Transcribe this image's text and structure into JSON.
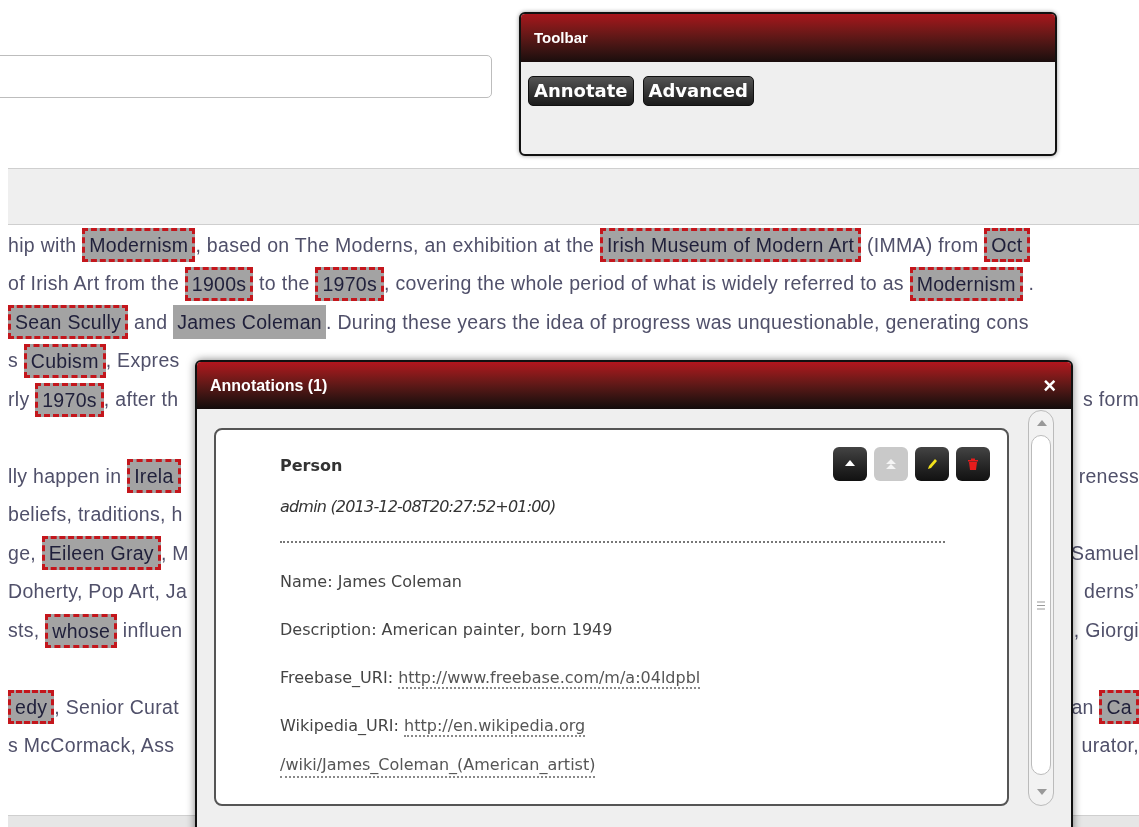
{
  "search": {
    "kind": "field"
  },
  "toolbar": {
    "title": "Toolbar",
    "buttons": [
      "Annotate",
      "Advanced"
    ]
  },
  "article": {
    "paragraphs": [
      {
        "lines": [
          {
            "left": [
              {
                "text": "hip with ",
                "kind": "plain"
              },
              {
                "text": "Modernism",
                "kind": "annotated"
              },
              {
                "text": ", based on The Moderns, an exhibition at the ",
                "kind": "plain"
              },
              {
                "text": "Irish Museum of Modern Art",
                "kind": "annotated"
              },
              {
                "text": " (IMMA) from ",
                "kind": "plain"
              },
              {
                "text": "Oct",
                "kind": "annotated"
              }
            ]
          },
          {
            "left": [
              {
                "text": "of Irish Art from the ",
                "kind": "plain"
              },
              {
                "text": "1900s",
                "kind": "annotated"
              },
              {
                "text": " to the ",
                "kind": "plain"
              },
              {
                "text": "1970s",
                "kind": "annotated"
              },
              {
                "text": ", covering the whole period of what is widely referred to as ",
                "kind": "plain"
              },
              {
                "text": "Modernism",
                "kind": "annotated"
              },
              {
                "text": " .",
                "kind": "plain"
              }
            ]
          },
          {
            "left": [
              {
                "text": "Sean Scully",
                "kind": "annotated"
              },
              {
                "text": " and ",
                "kind": "plain"
              },
              {
                "text": "James Coleman",
                "kind": "highlighted"
              },
              {
                "text": ". During these years the idea of progress was unquestionable, generating cons",
                "kind": "plain"
              }
            ]
          },
          {
            "left": [
              {
                "text": "s ",
                "kind": "plain"
              },
              {
                "text": "Cubism",
                "kind": "annotated"
              },
              {
                "text": ", Expres",
                "kind": "plain"
              }
            ]
          },
          {
            "left": [
              {
                "text": "rly ",
                "kind": "plain"
              },
              {
                "text": "1970s",
                "kind": "annotated"
              },
              {
                "text": ", after th",
                "kind": "plain"
              }
            ],
            "right": [
              {
                "text": "s form",
                "kind": "plain"
              }
            ]
          }
        ]
      },
      {
        "lines": [
          {
            "left": [
              {
                "text": "lly happen in ",
                "kind": "plain"
              },
              {
                "text": "Irela",
                "kind": "annotated"
              }
            ],
            "right": [
              {
                "text": "reness",
                "kind": "plain"
              }
            ]
          },
          {
            "left": [
              {
                "text": "beliefs, traditions, h",
                "kind": "plain"
              }
            ]
          },
          {
            "left": [
              {
                "text": "ge, ",
                "kind": "plain"
              },
              {
                "text": "Eileen Gray",
                "kind": "annotated"
              },
              {
                "text": ", M",
                "kind": "plain"
              }
            ],
            "right": [
              {
                "text": "Samuel",
                "kind": "plain"
              }
            ]
          },
          {
            "left": [
              {
                "text": "Doherty, Pop Art, Ja",
                "kind": "plain"
              }
            ],
            "right": [
              {
                "text": "derns’",
                "kind": "plain"
              }
            ]
          },
          {
            "left": [
              {
                "text": "sts, ",
                "kind": "plain"
              },
              {
                "text": "whose",
                "kind": "annotated"
              },
              {
                "text": " influen",
                "kind": "plain"
              }
            ],
            "right": [
              {
                "text": ", Giorgi",
                "kind": "plain"
              }
            ]
          }
        ]
      },
      {
        "lines": [
          {
            "left": [
              {
                "text": "edy",
                "kind": "annotated"
              },
              {
                "text": ", Senior Curat",
                "kind": "plain"
              }
            ],
            "right": [
              {
                "text": "an ",
                "kind": "plain"
              },
              {
                "text": "Ca",
                "kind": "annotated"
              }
            ]
          },
          {
            "left": [
              {
                "text": "s McCormack, Ass",
                "kind": "plain"
              }
            ],
            "right": [
              {
                "text": "urator,",
                "kind": "plain"
              }
            ]
          }
        ]
      }
    ]
  },
  "dialog": {
    "title": "Annotations (1)",
    "close": "×",
    "annotation": {
      "type": "Person",
      "author": "admin (2013-12-08T20:27:52+01:00)",
      "actions": [
        {
          "kind": "up",
          "disabled": false
        },
        {
          "kind": "top",
          "disabled": true
        },
        {
          "kind": "edit",
          "disabled": false
        },
        {
          "kind": "delete",
          "disabled": false
        }
      ],
      "fields": [
        {
          "label": "Name:",
          "value": "James Coleman"
        },
        {
          "label": "Description:",
          "value": "American painter, born 1949"
        },
        {
          "label": "Freebase_URI:",
          "link": "http://www.freebase.com/m/a:04ldpbl"
        },
        {
          "label": "Wikipedia_URI:",
          "link": "http://en.wikipedia.org",
          "link_continued": "/wiki/James_Coleman_(American_artist)"
        }
      ]
    }
  }
}
